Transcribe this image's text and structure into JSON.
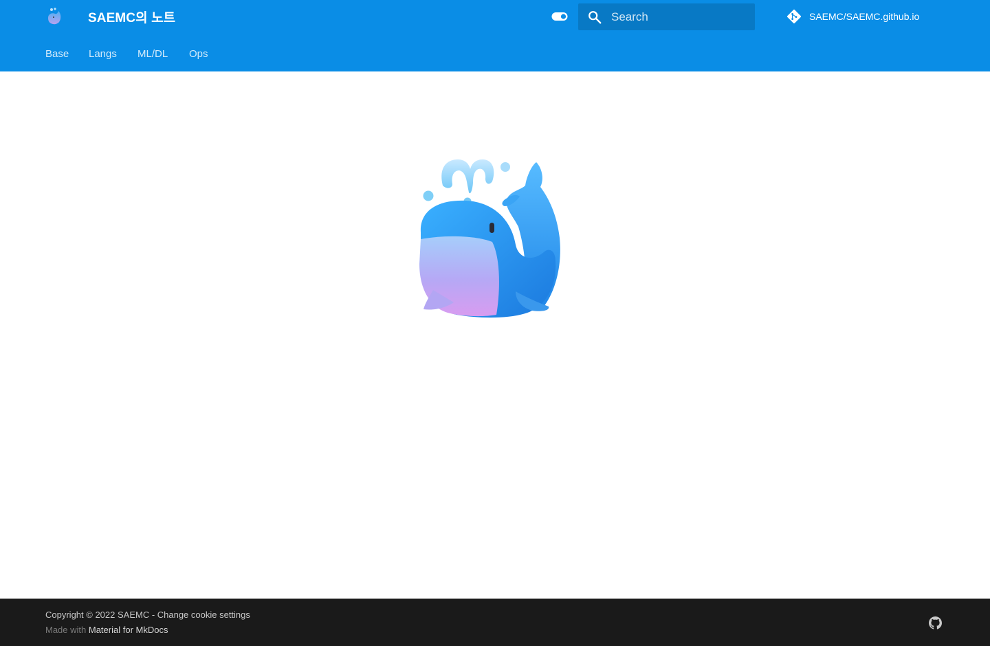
{
  "header": {
    "site_title": "SAEMC의 노트",
    "search": {
      "placeholder": "Search",
      "value": ""
    },
    "repo": {
      "name": "SAEMC/SAEMC.github.io"
    },
    "icons": {
      "logo": "whale-logo-icon",
      "palette_toggle": "toggle-switch-icon",
      "search": "search-icon",
      "repo": "git-icon"
    }
  },
  "tabs": [
    {
      "label": "Base"
    },
    {
      "label": "Langs"
    },
    {
      "label": "ML/DL"
    },
    {
      "label": "Ops"
    }
  ],
  "main": {
    "image": "spouting-whale-illustration"
  },
  "footer": {
    "copyright": "Copyright © 2022 SAEMC - Change cookie settings",
    "made_with_prefix": "Made with",
    "made_with_link": "Material for MkDocs",
    "social_icon": "github-icon"
  },
  "colors": {
    "primary": "#0a8de6",
    "footer_bg": "#1a1a1a"
  }
}
